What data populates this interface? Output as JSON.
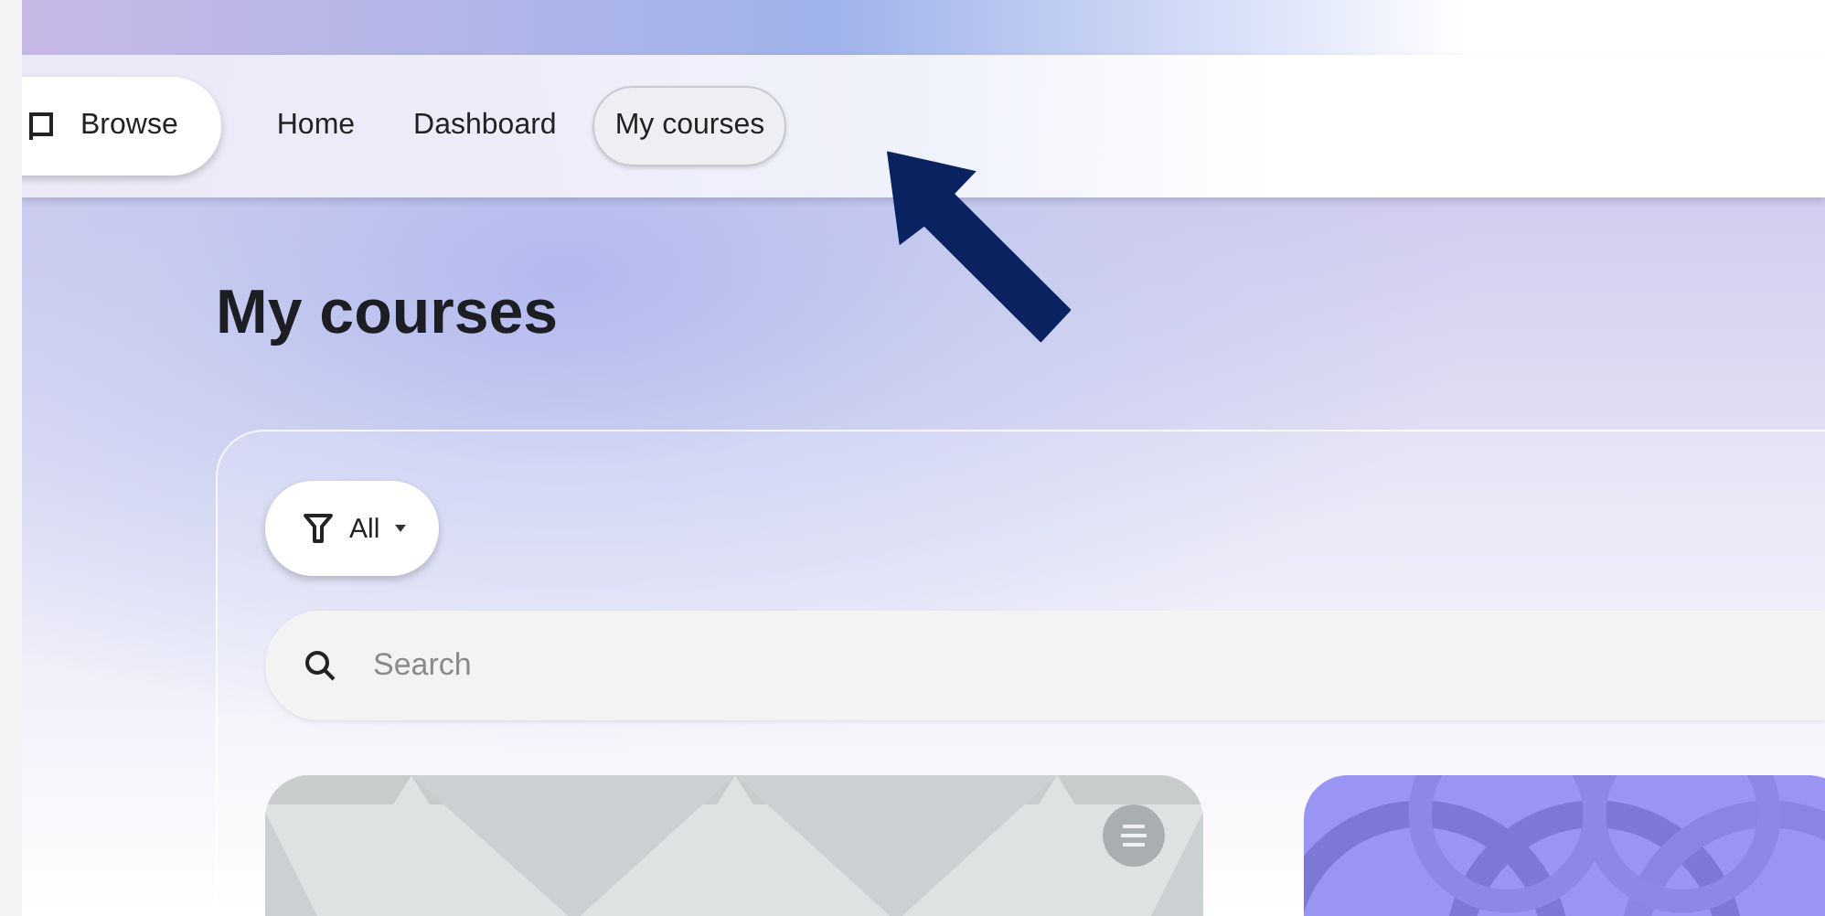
{
  "nav": {
    "items": [
      {
        "label": "Browse",
        "kind": "drawer",
        "selected": false
      },
      {
        "label": "Home",
        "kind": "link",
        "selected": false
      },
      {
        "label": "Dashboard",
        "kind": "link",
        "selected": false
      },
      {
        "label": "My courses",
        "kind": "link",
        "selected": true
      }
    ]
  },
  "page_title": "My courses",
  "filter": {
    "label": "All"
  },
  "search": {
    "placeholder": "Search"
  },
  "courses": [
    {
      "kind": "triangles",
      "has_menu": true
    },
    {
      "kind": "circles",
      "has_menu": false
    }
  ]
}
